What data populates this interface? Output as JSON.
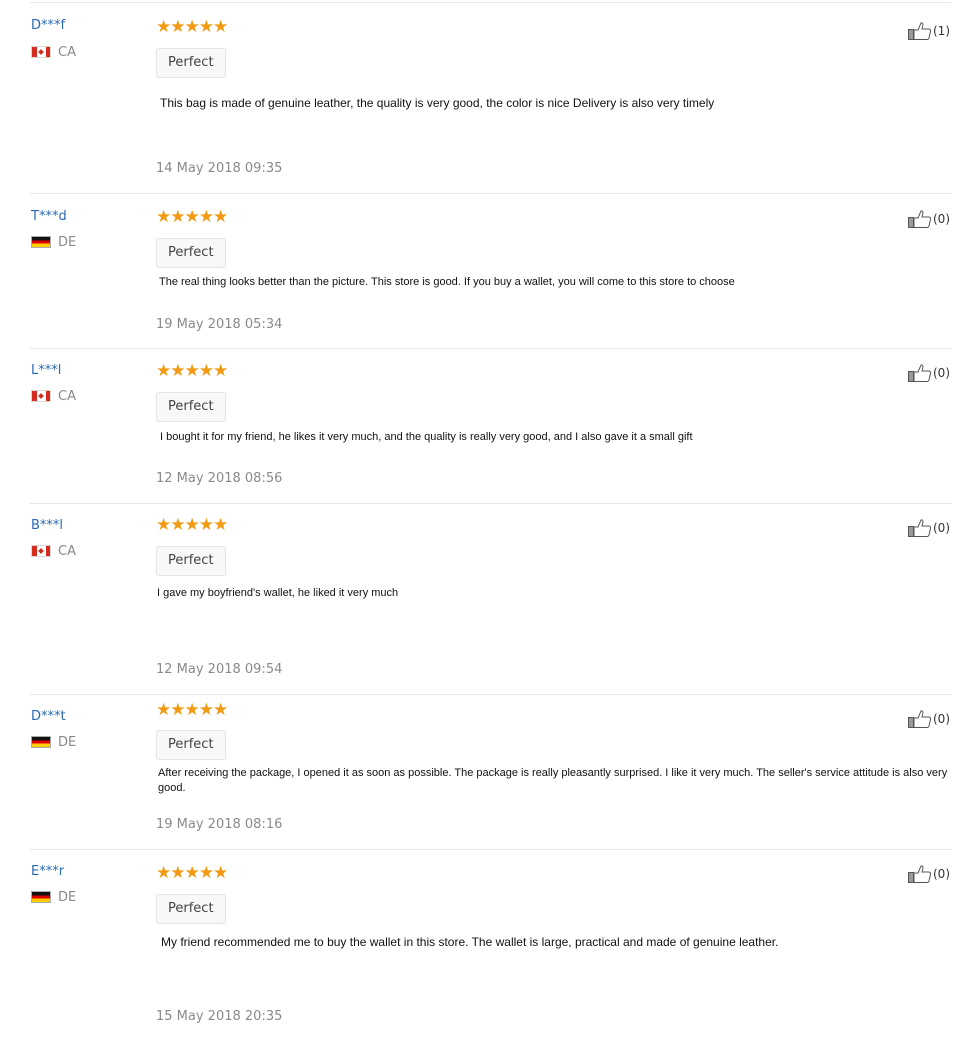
{
  "reviews": [
    {
      "user": "D***f",
      "country": "CA",
      "flag_icon": "canada-flag-icon",
      "stars": "★★★★★",
      "tag": "Perfect",
      "text": "This bag is made of genuine leather, the quality is very good, the color is nice Delivery is also very timely",
      "date": "14 May 2018 09:35",
      "helpful_count": "(1)"
    },
    {
      "user": "T***d",
      "country": "DE",
      "flag_icon": "germany-flag-icon",
      "stars": "★★★★★",
      "tag": "Perfect",
      "text": "The real thing looks better than the picture. This store is good. If you buy a wallet, you will come to this store to choose",
      "date": "19 May 2018 05:34",
      "helpful_count": "(0)"
    },
    {
      "user": "L***l",
      "country": "CA",
      "flag_icon": "canada-flag-icon",
      "stars": "★★★★★",
      "tag": "Perfect",
      "text": "I bought it for my friend, he likes it very much, and the quality is really very good, and I also gave it a small gift",
      "date": "12 May 2018 08:56",
      "helpful_count": "(0)"
    },
    {
      "user": "B***l",
      "country": "CA",
      "flag_icon": "canada-flag-icon",
      "stars": "★★★★★",
      "tag": "Perfect",
      "text": "I gave my boyfriend's wallet, he liked it very much",
      "date": "12 May 2018 09:54",
      "helpful_count": "(0)"
    },
    {
      "user": "D***t",
      "country": "DE",
      "flag_icon": "germany-flag-icon",
      "stars": "★★★★★",
      "tag": "Perfect",
      "text": "After receiving the package, I opened it as soon as possible. The package is really pleasantly surprised. I like it very much. The seller's service attitude is also very good.",
      "date": "19 May 2018 08:16",
      "helpful_count": "(0)"
    },
    {
      "user": "E***r",
      "country": "DE",
      "flag_icon": "germany-flag-icon",
      "stars": "★★★★★",
      "tag": "Perfect",
      "text": "My friend recommended me to buy the wallet in this store. The wallet is large, practical and made of genuine leather.",
      "date": "15 May 2018 20:35",
      "helpful_count": "(0)"
    }
  ],
  "colors": {
    "username": "#2a6ab5",
    "star": "#f29a12",
    "date": "#8a8a8a",
    "divider": "#e6e6e6"
  },
  "helpful_icon": "thumbs-up-icon",
  "rating_icon": "star-icon"
}
